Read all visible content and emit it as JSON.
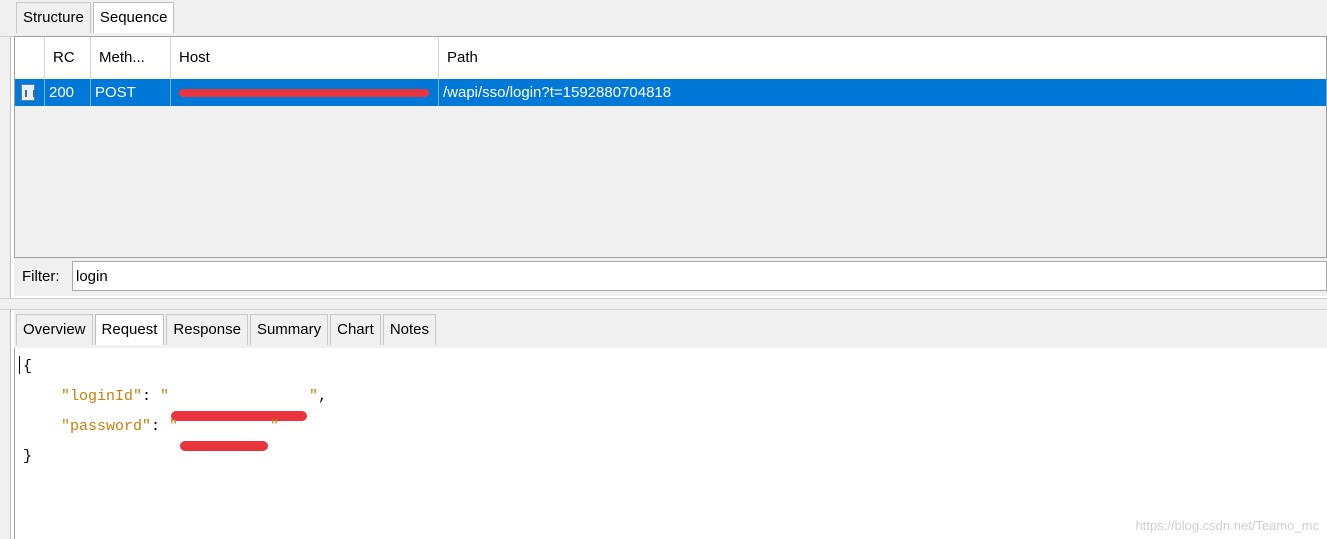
{
  "top_tabs": [
    "Structure",
    "Sequence"
  ],
  "grid": {
    "columns": [
      "RC",
      "Meth...",
      "Host",
      "Path"
    ],
    "rows": [
      {
        "rc": "200",
        "method": "POST",
        "host": "",
        "path": "/wapi/sso/login?t=1592880704818"
      }
    ]
  },
  "filter": {
    "label": "Filter:",
    "value": "login"
  },
  "bottom_tabs": [
    "Overview",
    "Request",
    "Response",
    "Summary",
    "Chart",
    "Notes"
  ],
  "request_body": {
    "open": "{",
    "key1": "\"loginId\"",
    "sep1": ": ",
    "quote": "\"",
    "key2": "\"password\"",
    "sep2": ": ",
    "comma": ",",
    "close": "}"
  },
  "watermark": "https://blog.csdn.net/Teamo_mc",
  "colors": {
    "selection": "#0078d7",
    "json_key": "#c87f0a",
    "redaction": "#e8343c"
  }
}
